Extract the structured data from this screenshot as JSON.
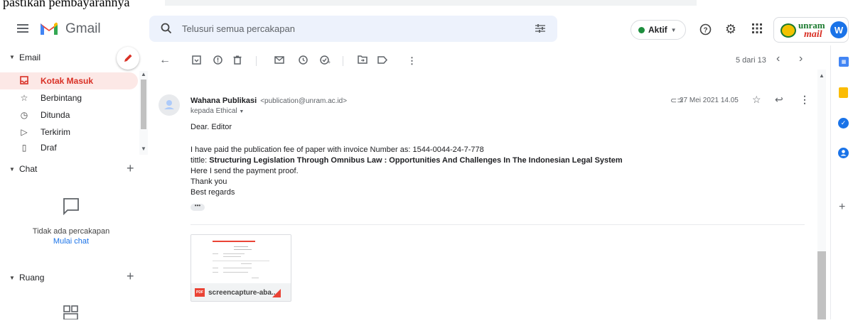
{
  "browser_strip_text": "pastikan pembayarannya",
  "header": {
    "app_name": "Gmail",
    "search_placeholder": "Telusuri semua percakapan",
    "status_label": "Aktif",
    "status_color": "#1e8e3e"
  },
  "sidebar": {
    "email_section": "Email",
    "items": [
      {
        "label": "Kotak Masuk",
        "icon": "inbox-icon",
        "active": true
      },
      {
        "label": "Berbintang",
        "icon": "star-icon"
      },
      {
        "label": "Ditunda",
        "icon": "clock-icon"
      },
      {
        "label": "Terkirim",
        "icon": "send-icon"
      },
      {
        "label": "Draf",
        "icon": "draft-icon"
      }
    ],
    "chat_section": "Chat",
    "chat_empty": "Tidak ada percakapan",
    "chat_start": "Mulai chat",
    "room_section": "Ruang"
  },
  "toolbar": {
    "pagination": "5 dari 13"
  },
  "message": {
    "sender_name": "Wahana Publikasi",
    "sender_email": "<publication@unram.ac.id>",
    "recipient": "kepada Ethical",
    "date": "27 Mei 2021 14.05",
    "greeting": "Dear. Editor",
    "line1": "I have paid the publication fee of paper with invoice Number as: 1544-0044-24-7-778",
    "title_prefix": "tittle: ",
    "title": "Structuring Legislation Through Omnibus Law : Opportunities And Challenges In The Indonesian Legal System",
    "line3": "Here I send the payment proof.",
    "line4": "Thank you",
    "line5": "Best regards",
    "attachment_name": "screencapture-aba...",
    "attachment_type": "PDF"
  },
  "account": {
    "logo_text_top": "unram",
    "logo_text_bottom": "mail",
    "avatar_letter": "W"
  }
}
